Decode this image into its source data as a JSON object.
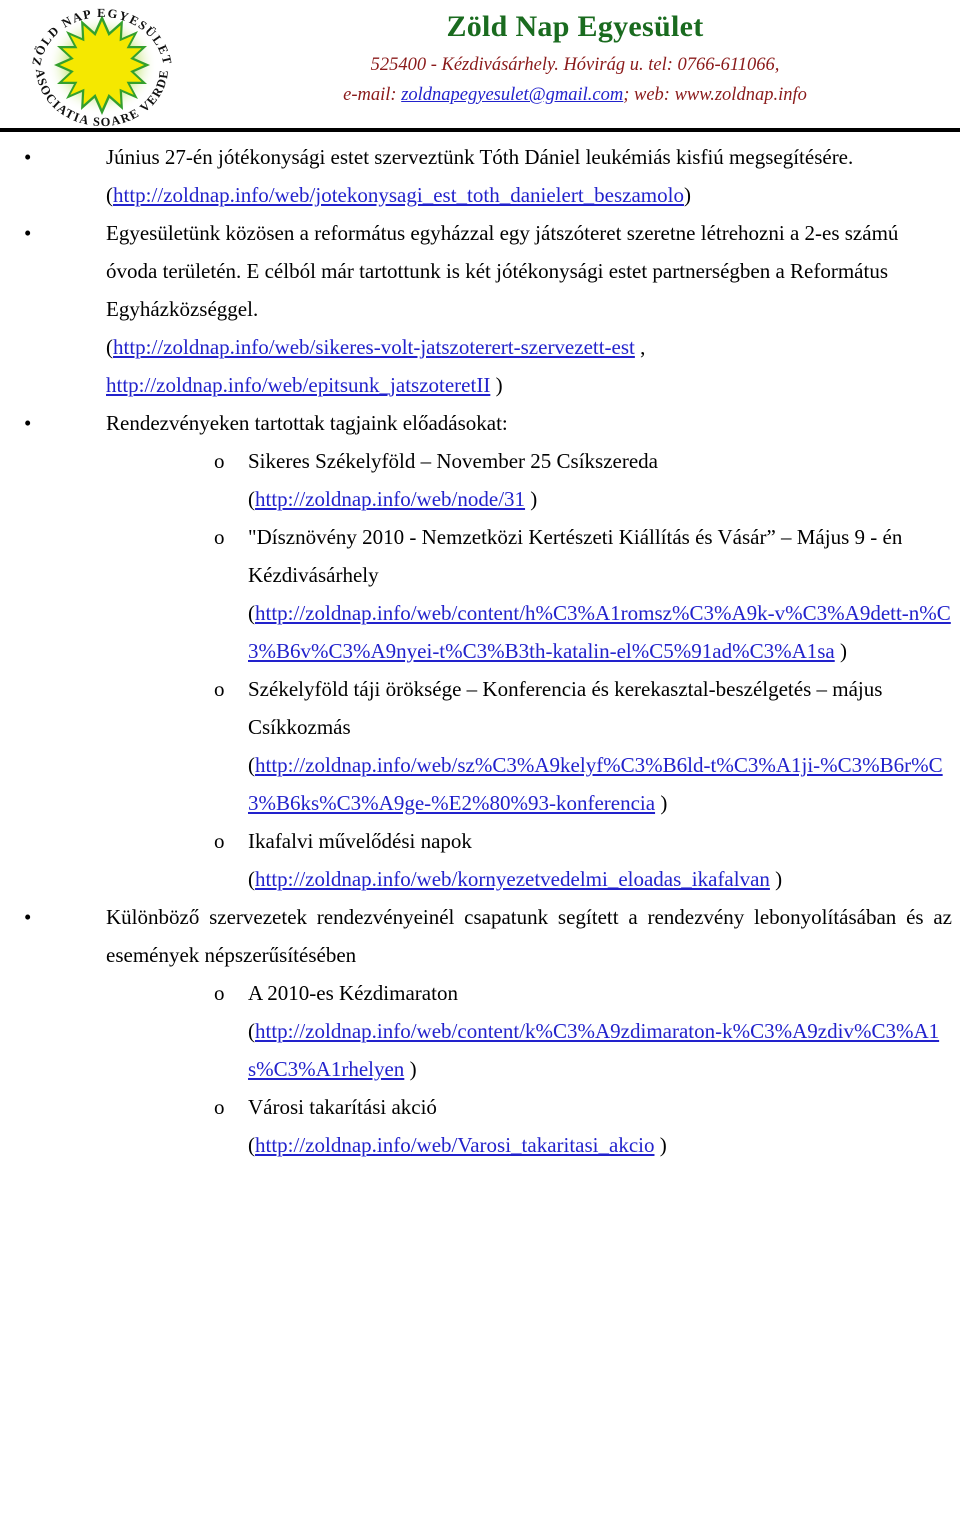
{
  "header": {
    "logo_outer_text_top": "ZÖLD NAP EGYESÜLET",
    "logo_outer_text_bottom": "ASOCIATIA SOARE VERDE",
    "title": "Zöld Nap Egyesület",
    "address": "525400 - Kézdivásárhely. Hóvirág u. tel: 0766-611066,",
    "contact_prefix": "e-mail: ",
    "email": "zoldnapegyesulet@gmail.com",
    "contact_suffix": "; web: www.zoldnap.info",
    "title_color": "#1a6b1f",
    "address_color": "#8a1a1a",
    "link_color": "#2222cc"
  },
  "body": {
    "items": [
      {
        "marker": "•",
        "text": "Június 27-én jótékonysági estet szerveztünk Tóth Dániel leukémiás kisfiú megsegítésére.",
        "url_open": "(",
        "url": "http://zoldnap.info/web/jotekonysagi_est_toth_danielert_beszamolo",
        "url_close": ")"
      },
      {
        "marker": "•",
        "text": "Egyesületünk közösen a református egyházzal egy játszóteret szeretne létrehozni a 2-es számú óvoda területén. E célból már tartottunk is két jótékonysági estet partnerségben a Református Egyházközséggel.",
        "url_open": "(",
        "url": "http://zoldnap.info/web/sikeres-volt-jatszoterert-szervezett-est",
        "url_mid": " , ",
        "url2": "http://zoldnap.info/web/epitsunk_jatszoteretII",
        "url_close": " )"
      },
      {
        "marker": "•",
        "text": "Rendezvényeken tartottak tagjaink előadásokat:",
        "subitems": [
          {
            "marker": "o",
            "text": "Sikeres Székelyföld – November 25 Csíkszereda",
            "url_open": "(",
            "url": "http://zoldnap.info/web/node/31",
            "url_close": " )"
          },
          {
            "marker": "o",
            "text": "\"Dísznövény 2010 - Nemzetközi Kertészeti Kiállítás és Vásár” – Május 9 - én Kézdivásárhely",
            "url_open": "(",
            "url": "http://zoldnap.info/web/content/h%C3%A1romsz%C3%A9k-v%C3%A9dett-n%C3%B6v%C3%A9nyei-t%C3%B3th-katalin-el%C5%91ad%C3%A1sa",
            "url_close": " )"
          },
          {
            "marker": "o",
            "text": "Székelyföld táji öröksége – Konferencia és kerekasztal-beszélgetés – május Csíkkozmás",
            "url_open": "(",
            "url": "http://zoldnap.info/web/sz%C3%A9kelyf%C3%B6ld-t%C3%A1ji-%C3%B6r%C3%B6ks%C3%A9ge-%E2%80%93-konferencia",
            "url_close": " )"
          },
          {
            "marker": "o",
            "text": "Ikafalvi művelődési napok",
            "url_open": "(",
            "url": "http://zoldnap.info/web/kornyezetvedelmi_eloadas_ikafalvan",
            "url_close": " )"
          }
        ]
      },
      {
        "marker": "•",
        "text": "Különböző szervezetek rendezvényeinél csapatunk segített a rendezvény lebonyolításában és az események népszerűsítésében",
        "subitems": [
          {
            "marker": "o",
            "text": "A 2010-es Kézdimaraton",
            "url_open": "(",
            "url": "http://zoldnap.info/web/content/k%C3%A9zdimaraton-k%C3%A9zdiv%C3%A1s%C3%A1rhelyen",
            "url_close": " )"
          },
          {
            "marker": "o",
            "text": "Városi takarítási akció",
            "url_open": "(",
            "url": "http://zoldnap.info/web/Varosi_takaritasi_akcio",
            "url_close": " )"
          }
        ]
      }
    ]
  }
}
